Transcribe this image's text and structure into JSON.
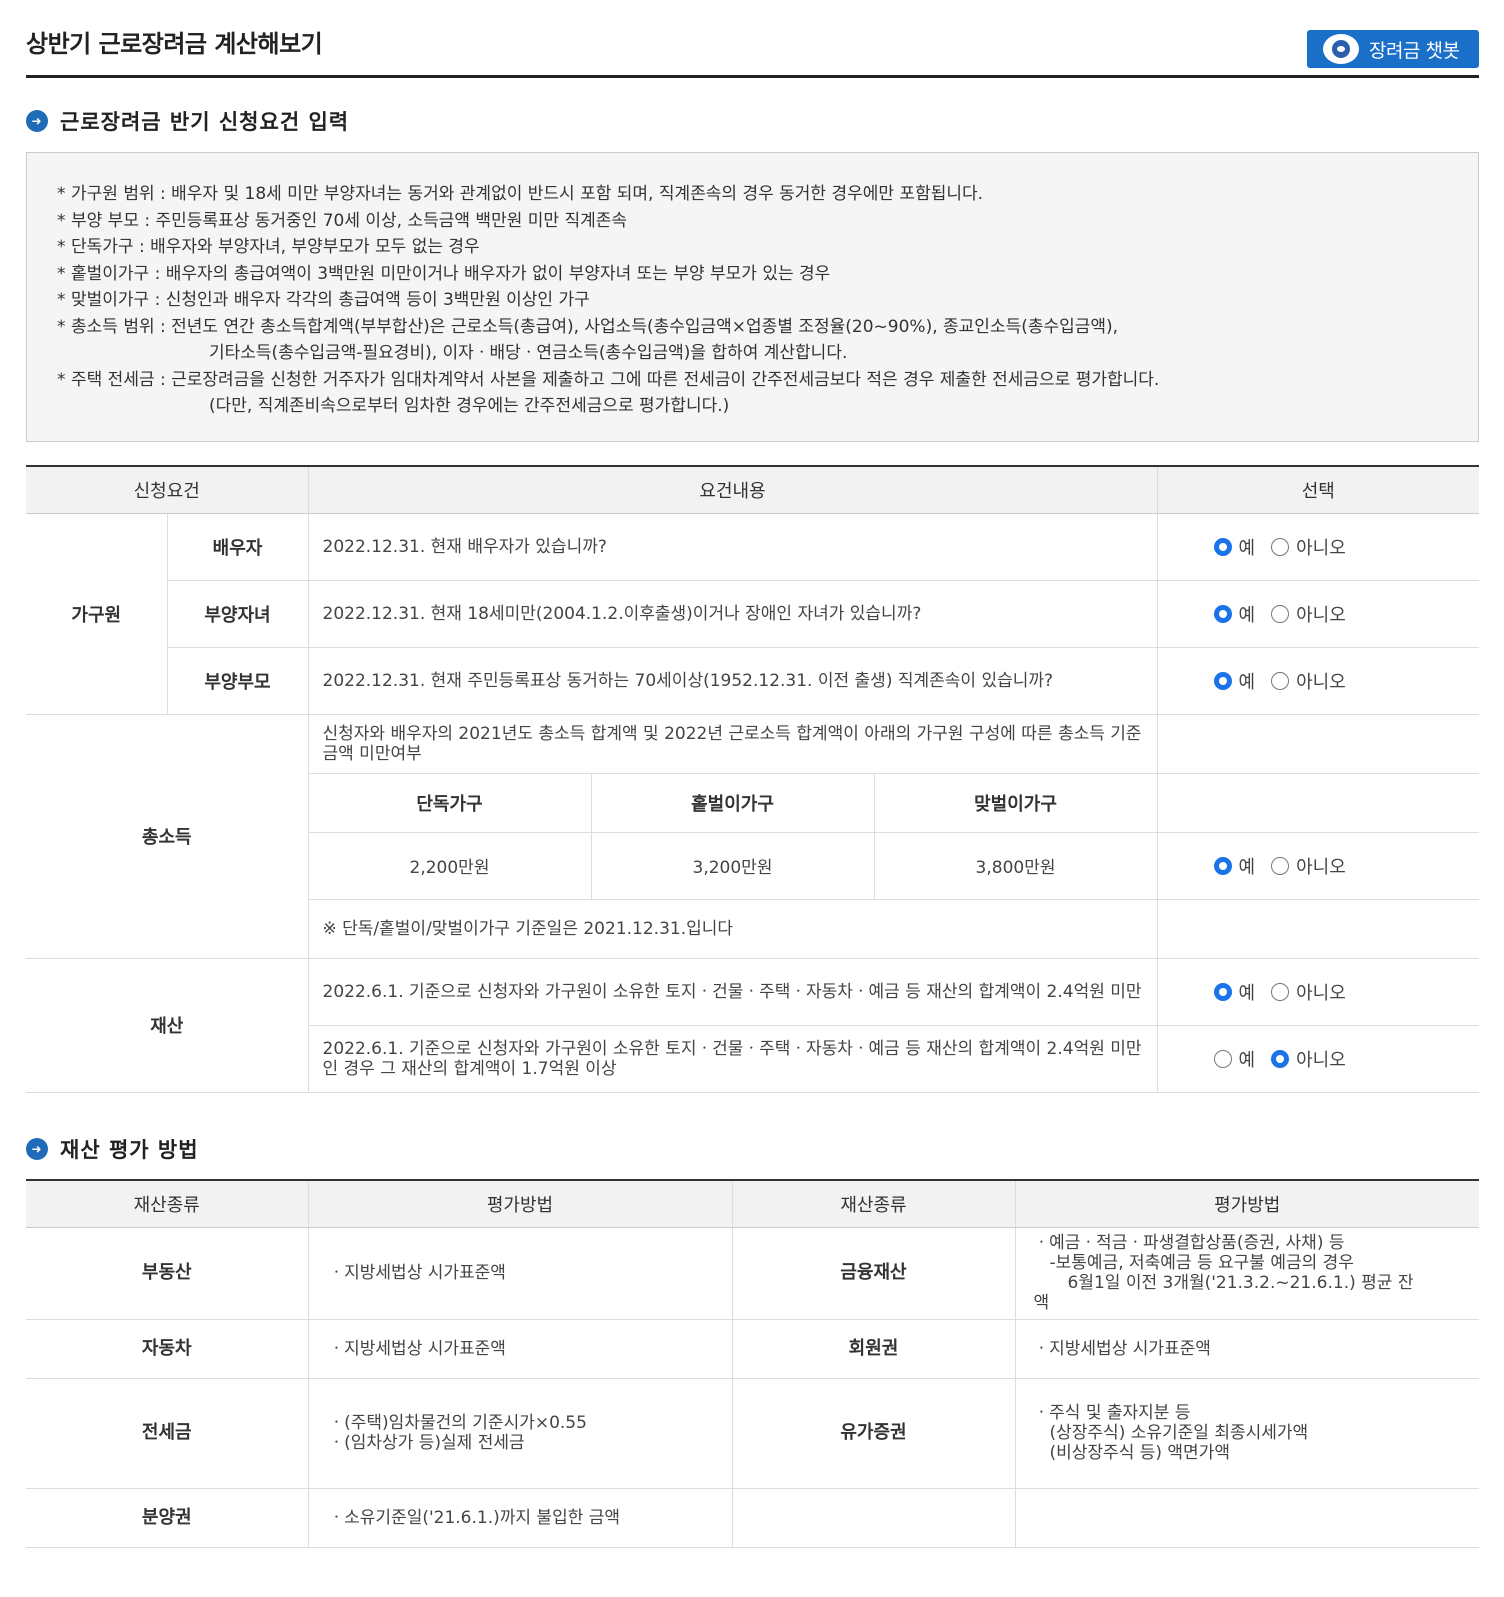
{
  "header": {
    "title": "상반기 근로장려금 계산해보기",
    "chatbot_label": "장려금 챗봇"
  },
  "section1": {
    "title": "근로장려금 반기 신청요건 입력"
  },
  "info": {
    "lines": [
      "가구원 범위 : 배우자 및 18세 미만 부양자녀는 동거와 관계없이 반드시 포함 되며, 직계존속의 경우 동거한 경우에만 포함됩니다.",
      "부양 부모 : 주민등록표상 동거중인 70세 이상, 소득금액 백만원 미만 직계존속",
      "단독가구 : 배우자와 부양자녀, 부양부모가 모두 없는 경우",
      "홑벌이가구 : 배우자의 총급여액이 3백만원 미만이거나 배우자가 없이 부양자녀 또는 부양 부모가 있는 경우",
      "맞벌이가구 : 신청인과 배우자 각각의 총급여액 등이 3백만원 이상인 가구",
      "총소득 범위 : 전년도 연간 총소득합계액(부부합산)은 근로소득(총급여), 사업소득(총수입금액×업종별 조정율(20~90%), 종교인소득(총수입금액),"
    ],
    "line6_cont": "기타소득(총수입금액-필요경비), 이자ㆍ배당ㆍ연금소득(총수입금액)을 합하여 계산합니다.",
    "line7": "주택 전세금 : 근로장려금을 신청한 거주자가 임대차계약서 사본을 제출하고 그에 따른 전세금이 간주전세금보다 적은 경우 제출한 전세금으로 평가합니다.",
    "line7_cont": "(다만, 직계존비속으로부터 임차한 경우에는 간주전세금으로 평가합니다.)"
  },
  "req_table": {
    "headers": [
      "신청요건",
      "요건내용",
      "선택"
    ],
    "yes_label": "예",
    "no_label": "아니오",
    "household": {
      "group": "가구원",
      "rows": [
        {
          "sub": "배우자",
          "text": "2022.12.31. 현재 배우자가 있습니까?",
          "selected": "yes"
        },
        {
          "sub": "부양자녀",
          "text": "2022.12.31. 현재 18세미만(2004.1.2.이후출생)이거나 장애인 자녀가 있습니까?",
          "selected": "yes"
        },
        {
          "sub": "부양부모",
          "text": "2022.12.31. 현재 주민등록표상 동거하는 70세이상(1952.12.31. 이전 출생) 직계존속이 있습니까?",
          "selected": "yes"
        }
      ]
    },
    "income": {
      "group": "총소득",
      "text": "신청자와 배우자의 2021년도 총소득 합계액 및 2022년 근로소득 합계액이 아래의 가구원 구성에 따른 총소득 기준금액 미만여부",
      "types": [
        "단독가구",
        "홑벌이가구",
        "맞벌이가구"
      ],
      "amounts": [
        "2,200만원",
        "3,200만원",
        "3,800만원"
      ],
      "note": "※ 단독/홑벌이/맞벌이가구 기준일은 2021.12.31.입니다",
      "selected": "yes"
    },
    "property": {
      "group": "재산",
      "rows": [
        {
          "text": "2022.6.1. 기준으로 신청자와 가구원이 소유한 토지ㆍ건물ㆍ주택ㆍ자동차ㆍ예금 등 재산의 합계액이 2.4억원 미만",
          "selected": "yes"
        },
        {
          "text": "2022.6.1. 기준으로 신청자와 가구원이 소유한 토지ㆍ건물ㆍ주택ㆍ자동차ㆍ예금 등 재산의 합계액이 2.4억원 미만인 경우 그 재산의 합계액이 1.7억원 이상",
          "selected": "no"
        }
      ]
    }
  },
  "section2": {
    "title": "재산 평가 방법"
  },
  "eval_table": {
    "headers": [
      "재산종류",
      "평가방법",
      "재산종류",
      "평가방법"
    ],
    "r1": {
      "kind_l": "부동산",
      "method_l": "ㆍ지방세법상 시가표준액",
      "kind_r": "금융재산",
      "m_r1": "ㆍ예금ㆍ적금ㆍ파생결합상품(증권, 사채) 등",
      "m_r2": "-보통예금, 저축예금 등 요구불 예금의 경우",
      "m_r3": "6월1일 이전 3개월('21.3.2.~21.6.1.) 평균 잔",
      "m_r4": "액"
    },
    "r2": {
      "kind_l": "자동차",
      "method_l": "ㆍ지방세법상 시가표준액",
      "kind_r": "회원권",
      "method_r": "ㆍ지방세법상 시가표준액"
    },
    "r3": {
      "kind_l": "전세금",
      "m_l1": "ㆍ(주택)임차물건의 기준시가×0.55",
      "m_l2": "ㆍ(임차상가 등)실제 전세금",
      "kind_r": "유가증권",
      "m_r1": "ㆍ주식 및 출자지분 등",
      "m_r2": "(상장주식) 소유기준일 최종시세가액",
      "m_r3": "(비상장주식 등) 액면가액"
    },
    "r4": {
      "kind_l": "분양권",
      "method_l": "ㆍ소유기준일('21.6.1.)까지 불입한 금액"
    }
  }
}
